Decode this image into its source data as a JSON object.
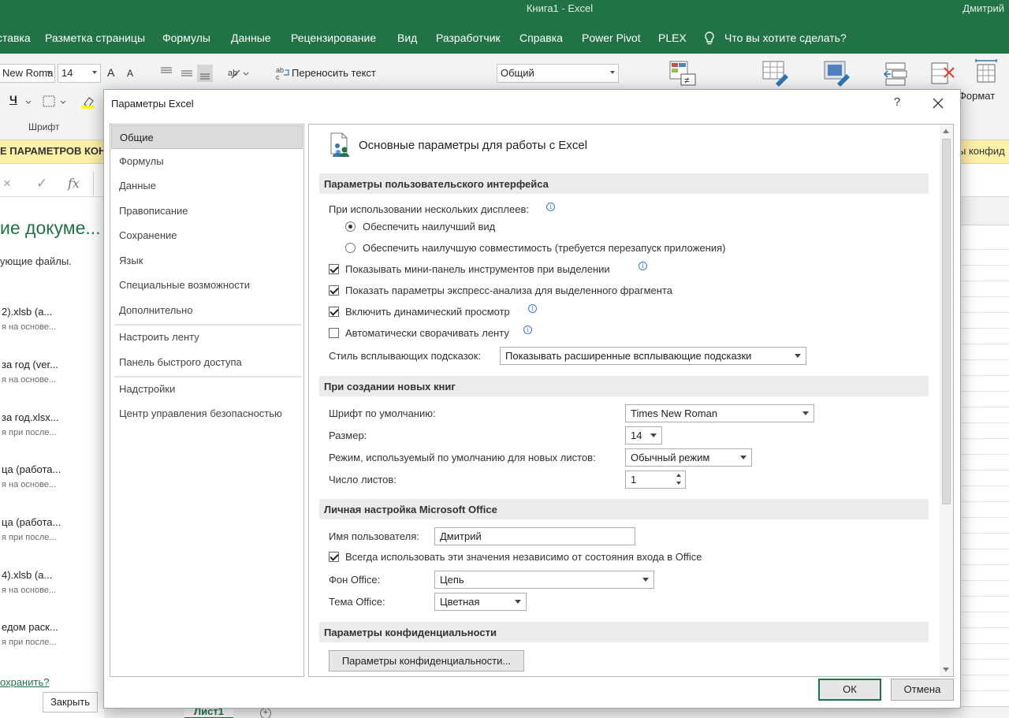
{
  "excel": {
    "window_title": "Книга1  -  Excel",
    "user": "Дмитрий",
    "tabs": [
      "ставка",
      "Разметка страницы",
      "Формулы",
      "Данные",
      "Рецензирование",
      "Вид",
      "Разработчик",
      "Справка",
      "Power Pivot",
      "PLEX",
      "Что вы хотите сделать?"
    ],
    "ribbon": {
      "font_name": "New Roma",
      "font_size": "14",
      "grow_font": "A",
      "shrink_font": "A",
      "wrap_text": "Переносить текст",
      "number_format": "Общий",
      "underline": "Ч",
      "font_group_label": "Шрифт",
      "format_label": "Формат"
    },
    "infobar": {
      "left_text": "Е ПАРАМЕТРОВ КОН",
      "right_text": "ы конфид"
    },
    "formula_icons": [
      "×",
      "✓",
      "fx"
    ],
    "recovery_panel": {
      "title": "ие докуме...",
      "subtitle": "ующие файлы.",
      "items": [
        {
          "name": "2).xlsb  (а...",
          "desc": "я на основе..."
        },
        {
          "name": "за год (ver...",
          "desc": "я на основе..."
        },
        {
          "name": "за год.xlsx...",
          "desc": "я при после..."
        },
        {
          "name": "ца (работа...",
          "desc": "я на основе..."
        },
        {
          "name": "ца (работа...",
          "desc": "я при после..."
        },
        {
          "name": "4).xlsb  (а...",
          "desc": "я на основе..."
        },
        {
          "name": "едом раск...",
          "desc": "я при после..."
        }
      ],
      "link": "охранить?",
      "close_button": "Закрыть"
    },
    "sheet_tab": "Лист1",
    "add_sheet": "+"
  },
  "dialog": {
    "title": "Параметры Excel",
    "help": "?",
    "nav": [
      "Общие",
      "Формулы",
      "Данные",
      "Правописание",
      "Сохранение",
      "Язык",
      "Специальные возможности",
      "Дополнительно",
      "Настроить ленту",
      "Панель быстрого доступа",
      "Надстройки",
      "Центр управления безопасностью"
    ],
    "selected_nav": "Общие",
    "heading": "Основные параметры для работы с Excel",
    "sections": {
      "ui": "Параметры пользовательского интерфейса",
      "new_books": "При создании новых книг",
      "personal": "Личная настройка Microsoft Office",
      "privacy": "Параметры конфиденциальности"
    },
    "multi_display_label": "При использовании нескольких дисплеев:",
    "radio_best_view": "Обеспечить наилучший вид",
    "radio_compat": "Обеспечить наилучшую совместимость (требуется перезапуск приложения)",
    "cb_minitoolbar": "Показывать мини-панель инструментов при выделении",
    "cb_quick_analysis": "Показать параметры экспресс-анализа для выделенного фрагмента",
    "cb_live_preview": "Включить динамический просмотр",
    "cb_collapse_ribbon": "Автоматически сворачивать ленту",
    "tooltip_style_label": "Стиль всплывающих подсказок:",
    "tooltip_style_value": "Показывать расширенные всплывающие подсказки",
    "default_font_label": "Шрифт по умолчанию:",
    "default_font_value": "Times New Roman",
    "size_label": "Размер:",
    "size_value": "14",
    "view_mode_label": "Режим, используемый по умолчанию для новых листов:",
    "view_mode_value": "Обычный режим",
    "sheets_count_label": "Число листов:",
    "sheets_count_value": "1",
    "username_label": "Имя пользователя:",
    "username_value": "Дмитрий",
    "cb_always_use": "Всегда использовать эти значения независимо от состояния входа в Office",
    "office_bg_label": "Фон Office:",
    "office_bg_value": "Цепь",
    "office_theme_label": "Тема Office:",
    "office_theme_value": "Цветная",
    "privacy_button": "Параметры конфиденциальности...",
    "ok": "ОК",
    "cancel": "Отмена",
    "checkbox_states": {
      "minitoolbar": true,
      "quick_analysis": true,
      "live_preview": true,
      "collapse_ribbon": false,
      "always_use": true
    },
    "radio_selected": "best_view"
  },
  "colors": {
    "excel_green": "#217346",
    "info_bar": "#fff1a8",
    "section_bg": "#ebebeb"
  }
}
